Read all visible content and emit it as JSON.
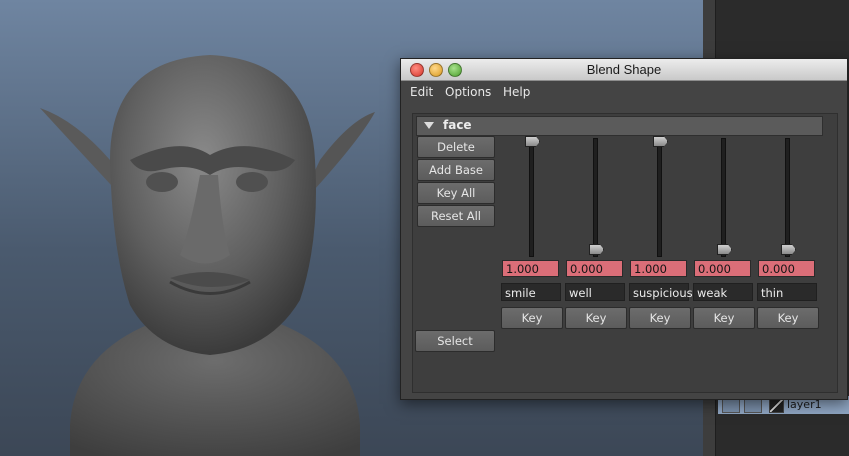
{
  "window": {
    "title": "Blend Shape"
  },
  "menu": [
    "Edit",
    "Options",
    "Help"
  ],
  "blendshape": {
    "node_name": "face",
    "buttons": {
      "delete": "Delete",
      "add_base": "Add Base",
      "key_all": "Key All",
      "reset_all": "Reset All",
      "select": "Select"
    },
    "targets": [
      {
        "name": "smile",
        "value": "1.000",
        "weight": 1.0,
        "key": "Key"
      },
      {
        "name": "well",
        "value": "0.000",
        "weight": 0.0,
        "key": "Key"
      },
      {
        "name": "suspicious",
        "value": "1.000",
        "weight": 1.0,
        "key": "Key"
      },
      {
        "name": "weak",
        "value": "0.000",
        "weight": 0.0,
        "key": "Key"
      },
      {
        "name": "thin",
        "value": "0.000",
        "weight": 0.0,
        "key": "Key"
      }
    ]
  },
  "layer_panel": {
    "layer_name": "layer1"
  },
  "colors": {
    "keyed_field": "#db6e78",
    "window_bg": "#444444"
  }
}
